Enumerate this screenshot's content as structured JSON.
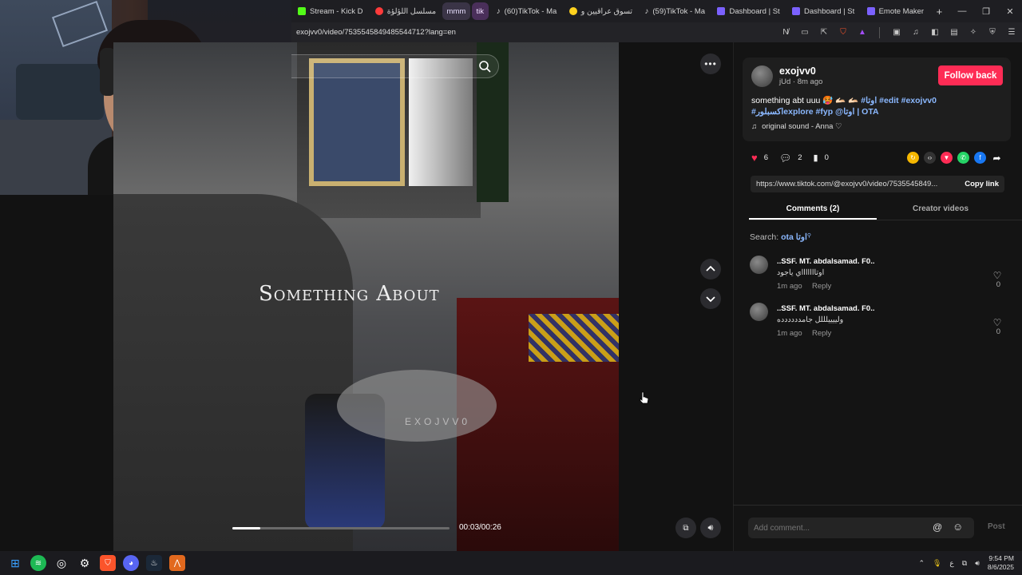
{
  "browser": {
    "tabs": [
      {
        "label": "Stream - Kick D",
        "icon_color": "#53fc18"
      },
      {
        "label": "مسلسل اللؤلؤة",
        "icon_color": "#ff3b3b"
      },
      {
        "label": "mmm",
        "group": true
      },
      {
        "label": "tik",
        "group": true
      },
      {
        "label": "(60)TikTok - Ma",
        "icon_color": "#ffffff"
      },
      {
        "label": "تسوق عراقيين و",
        "icon_color": "#ffd21e"
      },
      {
        "label": "(59)TikTok - Ma",
        "icon_color": "#ffffff"
      },
      {
        "label": "Dashboard | St",
        "icon_color": "#7b61ff"
      },
      {
        "label": "Dashboard | St",
        "icon_color": "#7b61ff"
      },
      {
        "label": "Emote Maker",
        "icon_color": "#7b61ff"
      }
    ],
    "new_tab": "+",
    "url": "exojvv0/video/7535545849485544712?lang=en"
  },
  "video": {
    "overlay_title": "Something About",
    "watermark": "EXOJVV0",
    "time": "00:03/00:26",
    "progress_fraction": 0.13
  },
  "post": {
    "author": "exojvv0",
    "meta": "jUd · 8m ago",
    "follow_label": "Follow back",
    "caption_text": "something abt uuu 🥵 🫴🏻 🫴🏻",
    "hashtags_line1": [
      "#اوتا",
      "#edit",
      "#exojvv0"
    ],
    "hashtags_line2": "#اكسبلورexplore #fyp @اوتا | OTA",
    "sound": "original sound - Anna ♡︎",
    "likes": "6",
    "comments": "2",
    "saves": "0",
    "link": "https://www.tiktok.com/@exojvv0/video/7535545849...",
    "copy_label": "Copy link"
  },
  "panel_tabs": {
    "comments": "Comments (2)",
    "creator": "Creator videos"
  },
  "search": {
    "prefix": "Search:",
    "term": "ota اوتا"
  },
  "comments": [
    {
      "user": "..SSF. MT. abdalsamad. F0..",
      "text": "اوتاااااااي ياجود",
      "time": "1m ago",
      "reply": "Reply",
      "likes": "0"
    },
    {
      "user": "..SSF. MT. abdalsamad. F0..",
      "text": "ولييييلللل جامدددددده",
      "time": "1m ago",
      "reply": "Reply",
      "likes": "0"
    }
  ],
  "composer": {
    "placeholder": "Add comment...",
    "post_label": "Post"
  },
  "taskbar": {
    "clock_time": "9:54 PM",
    "clock_date": "8/6/2025",
    "lang": "ع"
  }
}
